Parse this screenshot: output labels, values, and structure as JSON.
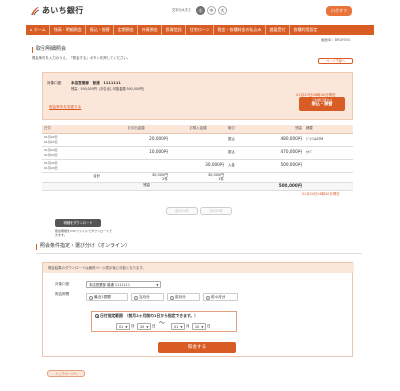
{
  "header": {
    "bank_name": "あいち銀行",
    "font_size_label": "文字の大きさ",
    "font_sizes": [
      "小",
      "中",
      "大"
    ],
    "logout_label": "ログオフ"
  },
  "nav": {
    "items": [
      "ホーム",
      "残高・明細照会",
      "振込・振替",
      "定期預金",
      "外貨預金",
      "投資信託",
      "住宅ローン",
      "税金・各種料金の払込み",
      "諸届受付",
      "各種利用設定"
    ]
  },
  "screen_id": "画面ID：BRDY050",
  "page": {
    "title": "取引明細照会",
    "instruction": "照会条件を入力のうえ、「照会する」ボタンを押してください。",
    "bottom_link": "ページ下部へ"
  },
  "account": {
    "label": "対象口座",
    "value": "本店営業部　普通　1111111",
    "balance_line": "残高：500,000円（お引出し可能金額 500,000円）",
    "change_link": "照会条件を変更する",
    "timestamp": "01月20日08時30分現在",
    "transfer_button_line1": "ご利用口座から",
    "transfer_button_line2": "振込・振替"
  },
  "table": {
    "headers": [
      "日付",
      "お引出金額",
      "お預入金額",
      "取引",
      "残高",
      "摘要"
    ],
    "rows": [
      {
        "date": "01月20日\n01月20日",
        "withdraw": "20,000円",
        "deposit": "",
        "type": "振込",
        "balance": "480,000円",
        "memo": "ｼﾞｴｲｺﾑATM"
      },
      {
        "date": "01月20日\n01月20日",
        "withdraw": "10,000円",
        "deposit": "",
        "type": "振込",
        "balance": "470,000円",
        "memo": "ｶｲｼﾞ"
      },
      {
        "date": "01月20日\n01月20日",
        "withdraw": "",
        "deposit": "30,000円",
        "type": "入金",
        "balance": "500,000円",
        "memo": ""
      }
    ],
    "total_label": "合計",
    "total_withdraw": "30,000円\n2件",
    "total_deposit": "30,000円\n1件",
    "balance_label": "残高",
    "balance_value": "500,000円",
    "as_of": "01月20日08時30分現在"
  },
  "pager": {
    "prev": "前の20件",
    "next": "次の20件"
  },
  "download": {
    "button": "明細をダウンロード",
    "note_line1": "照会明細をCSVファイルでダウンロードで",
    "note_line2": "きます。"
  },
  "conditions": {
    "section_title": "照会条件指定・選び分け（オンライン）",
    "note": "照会結果のダウンロードは最終ページ表示後に可能となります。",
    "account_label": "対象口座",
    "account_select": "本店営業部 普通 1111111",
    "period_label": "照会期間",
    "period_options": [
      "最近1週間",
      "当月分",
      "前月分",
      "前々月分"
    ],
    "date_range_title": "日付指定範囲　（前月2ヶ月間の1日から指定できます。）",
    "from_month": "01",
    "from_day": "20",
    "to_month": "01",
    "to_day": "20",
    "month_unit": "月",
    "day_unit": "日",
    "tilde": "〜",
    "submit": "照会する"
  },
  "footer": {
    "top_button": "トップページへ"
  }
}
